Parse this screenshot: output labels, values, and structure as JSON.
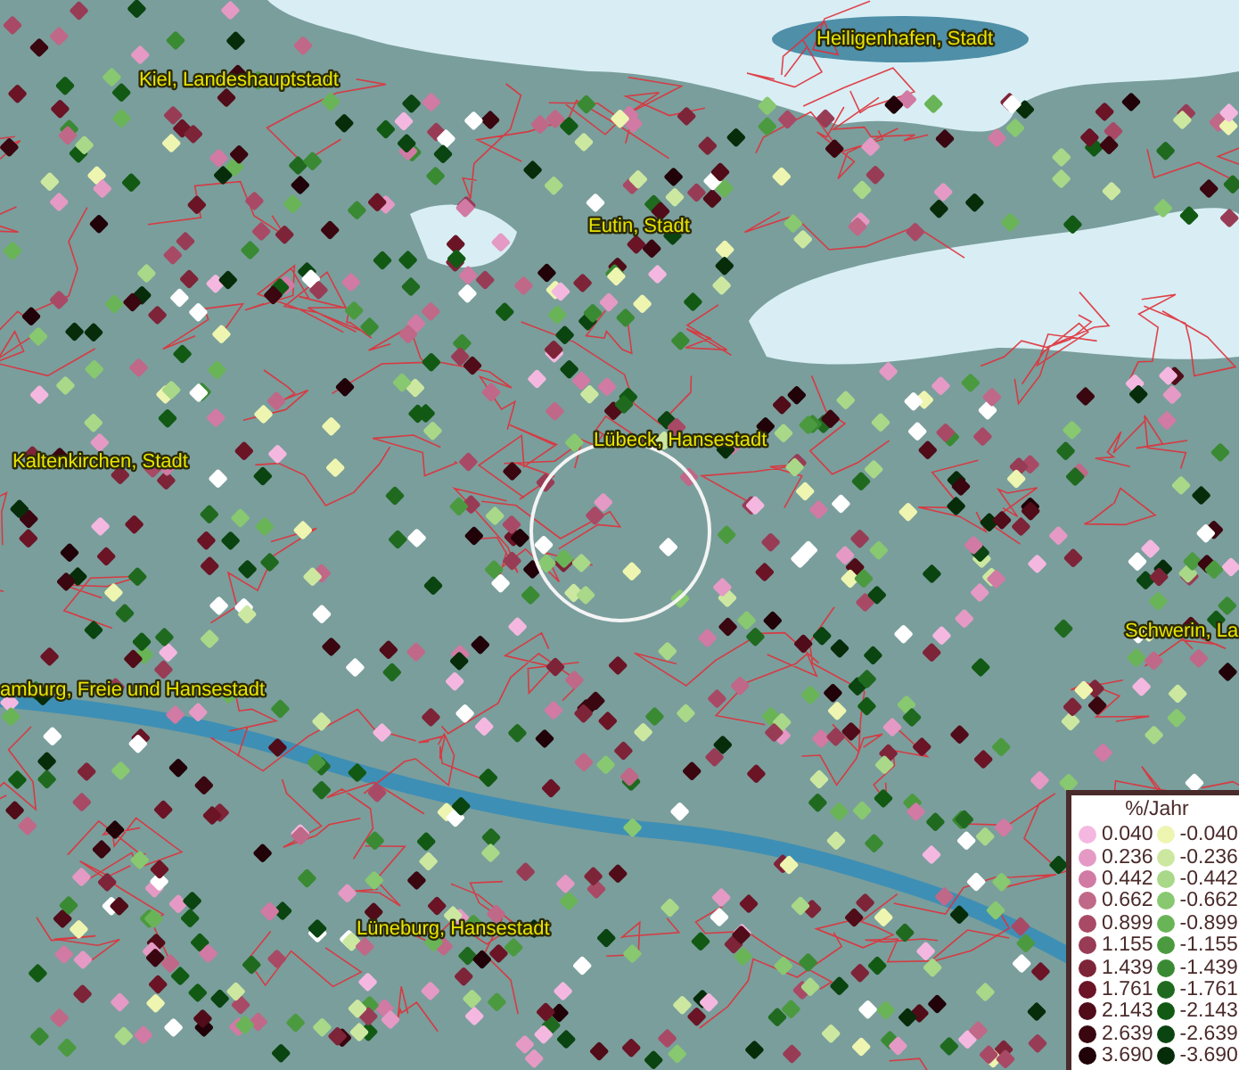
{
  "map": {
    "places": [
      {
        "label": "Kiel, Landeshauptstadt"
      },
      {
        "label": "Heiligenhafen, Stadt"
      },
      {
        "label": "Eutin, Stadt"
      },
      {
        "label": "Lübeck, Hansestadt"
      },
      {
        "label": "Kaltenkirchen, Stadt"
      },
      {
        "label": "Schwerin, La"
      },
      {
        "label": "amburg, Freie und Hansestadt"
      },
      {
        "label": "Lüneburg, Hansestadt"
      }
    ]
  },
  "legend": {
    "title": "%/Jahr",
    "columns": [
      [
        {
          "label": "0.040",
          "color": "#f4b8e0"
        },
        {
          "label": "0.236",
          "color": "#e49ac4"
        },
        {
          "label": "0.442",
          "color": "#d07aa4"
        },
        {
          "label": "0.662",
          "color": "#c06888"
        },
        {
          "label": "0.899",
          "color": "#a84a66"
        },
        {
          "label": "1.155",
          "color": "#983c56"
        },
        {
          "label": "1.439",
          "color": "#7e2438"
        },
        {
          "label": "1.761",
          "color": "#6a1426"
        },
        {
          "label": "2.143",
          "color": "#500c18"
        },
        {
          "label": "2.639",
          "color": "#3a0610"
        },
        {
          "label": "3.690",
          "color": "#200208"
        }
      ],
      [
        {
          "label": "-0.040",
          "color": "#eef5b0"
        },
        {
          "label": "-0.236",
          "color": "#cce8a0"
        },
        {
          "label": "-0.442",
          "color": "#a8d888"
        },
        {
          "label": "-0.662",
          "color": "#88c870"
        },
        {
          "label": "-0.899",
          "color": "#6ab458"
        },
        {
          "label": "-1.155",
          "color": "#4c9a40"
        },
        {
          "label": "-1.439",
          "color": "#3a8a34"
        },
        {
          "label": "-1.761",
          "color": "#206a20"
        },
        {
          "label": "-2.143",
          "color": "#125a14"
        },
        {
          "label": "-2.639",
          "color": "#0a4410"
        },
        {
          "label": "-3.690",
          "color": "#062c0a"
        }
      ]
    ]
  }
}
